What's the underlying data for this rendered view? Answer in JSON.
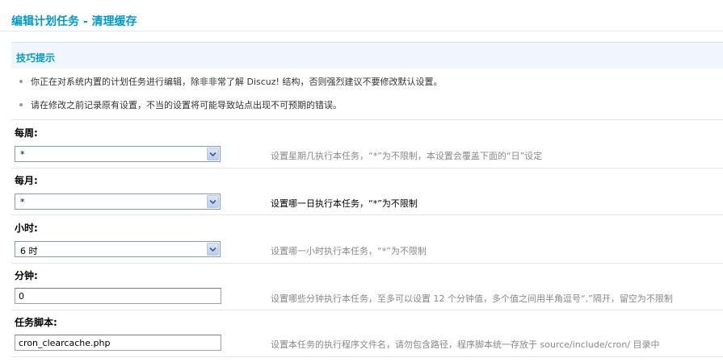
{
  "page": {
    "title": "编辑计划任务 - 清理缓存"
  },
  "tips": {
    "heading": "技巧提示",
    "items": [
      "你正在对系统内置的计划任务进行编辑，除非非常了解 Discuz! 结构，否则强烈建议不要修改默认设置。",
      "请在修改之前记录原有设置，不当的设置将可能导致站点出现不可预期的错误。"
    ]
  },
  "form": {
    "weekday": {
      "label": "每周:",
      "value": "*",
      "hint": "设置星期几执行本任务，“*”为不限制，本设置会覆盖下面的“日”设定"
    },
    "day": {
      "label": "每月:",
      "value": "*",
      "hint": "设置哪一日执行本任务，“*”为不限制"
    },
    "hour": {
      "label": "小时:",
      "value": "6 时",
      "hint": "设置哪一小时执行本任务，“*”为不限制"
    },
    "minute": {
      "label": "分钟:",
      "value": "0",
      "hint": "设置哪些分钟执行本任务，至多可以设置 12 个分钟值，多个值之间用半角逗号“,”隔开，留空为不限制"
    },
    "script": {
      "label": "任务脚本:",
      "value": "cron_clearcache.php",
      "hint": "设置本任务的执行程序文件名，请勿包含路径，程序脚本统一存放于 source/include/cron/ 目录中"
    }
  },
  "colors": {
    "title": "#0099cc",
    "tips_background": "#f0f6fb",
    "hint_text": "#888888",
    "hint_active_text": "#000000"
  },
  "icons": {
    "select_arrow": "chevron-down-icon",
    "tip_bullet": "bullet-dot-icon"
  }
}
